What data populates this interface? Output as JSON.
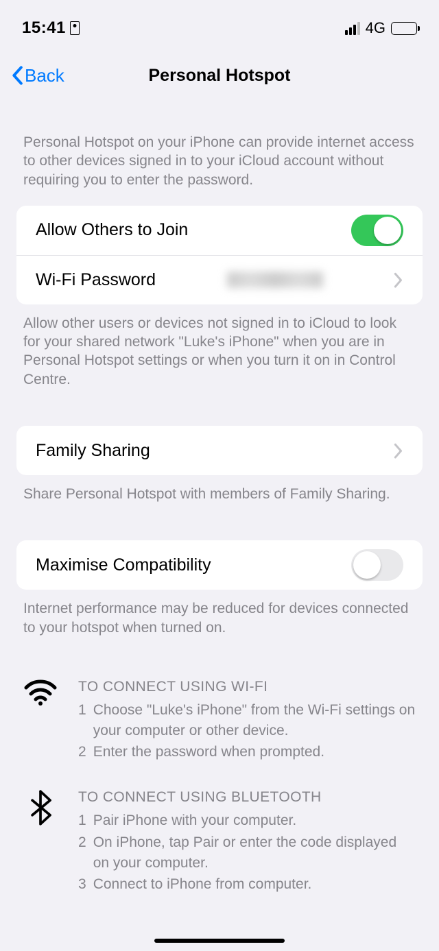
{
  "status": {
    "time": "15:41",
    "network_label": "4G"
  },
  "nav": {
    "back_label": "Back",
    "title": "Personal Hotspot"
  },
  "section1": {
    "header": "Personal Hotspot on your iPhone can provide internet access to other devices signed in to your iCloud account without requiring you to enter the password.",
    "allow_label": "Allow Others to Join",
    "allow_on": true,
    "wifi_password_label": "Wi-Fi Password",
    "footer": "Allow other users or devices not signed in to iCloud to look for your shared network \"Luke's iPhone\" when you are in Personal Hotspot settings or when you turn it on in Control Centre."
  },
  "section2": {
    "family_label": "Family Sharing",
    "footer": "Share Personal Hotspot with members of Family Sharing."
  },
  "section3": {
    "compat_label": "Maximise Compatibility",
    "compat_on": false,
    "footer": "Internet performance may be reduced for devices connected to your hotspot when turned on."
  },
  "instructions": {
    "wifi": {
      "heading": "TO CONNECT USING WI-FI",
      "steps": [
        "Choose \"Luke's iPhone\" from the Wi-Fi settings on your computer or other device.",
        "Enter the password when prompted."
      ]
    },
    "bt": {
      "heading": "TO CONNECT USING BLUETOOTH",
      "steps": [
        "Pair iPhone with your computer.",
        "On iPhone, tap Pair or enter the code displayed on your computer.",
        "Connect to iPhone from computer."
      ]
    }
  }
}
